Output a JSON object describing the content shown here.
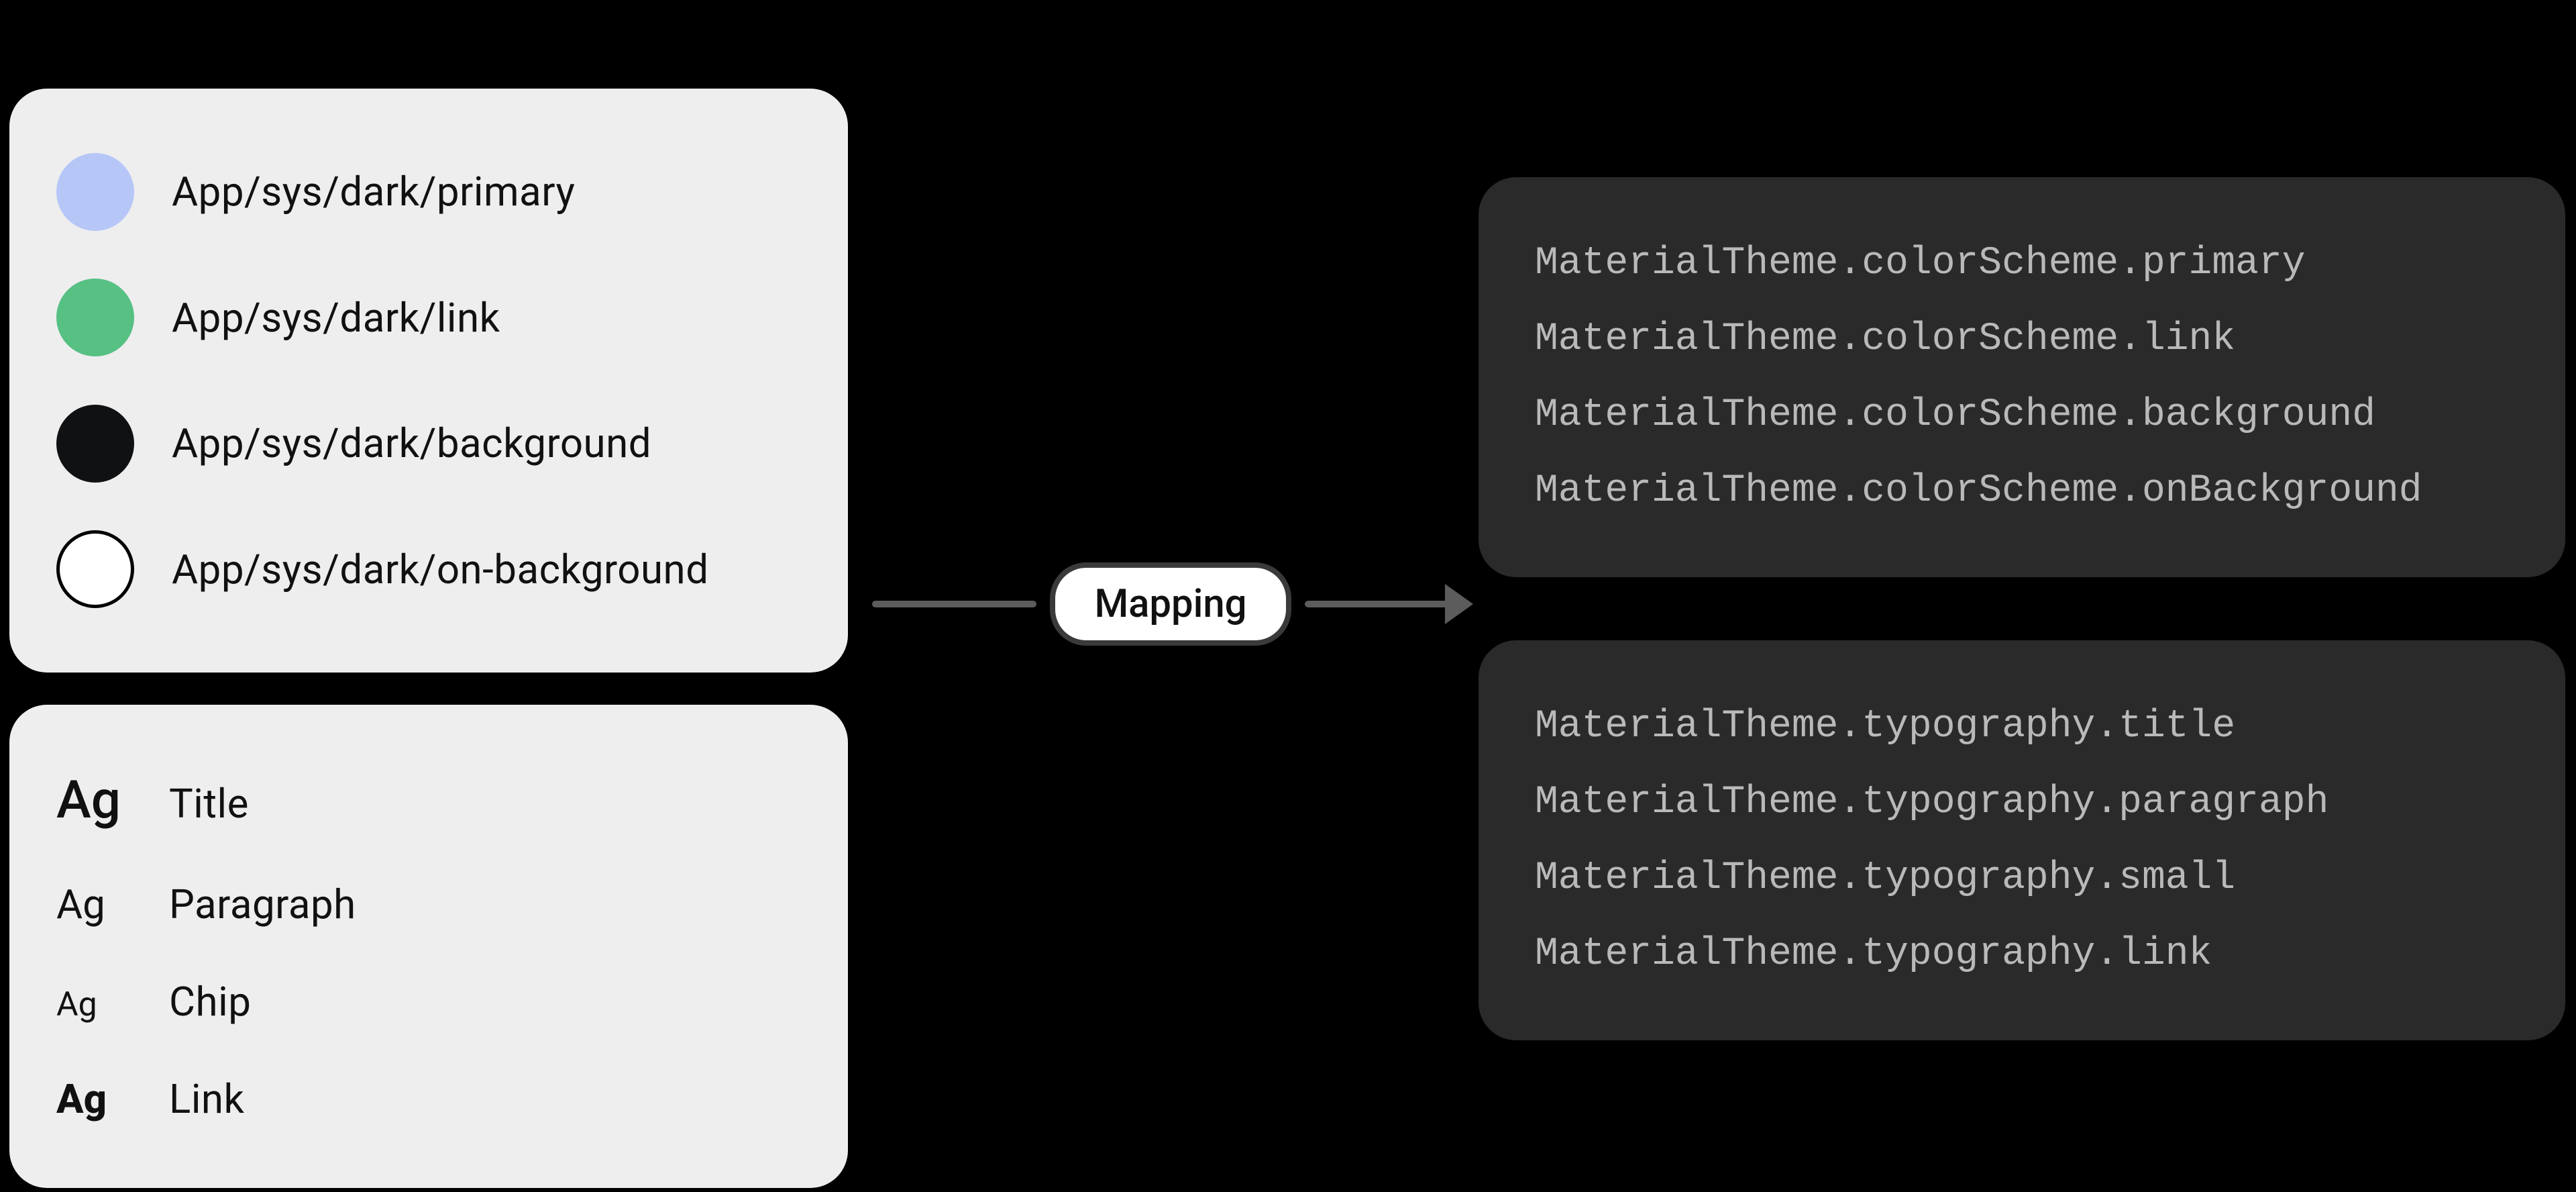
{
  "colors": {
    "tokens": [
      {
        "label": "App/sys/dark/primary",
        "hex": "#b6c7f7",
        "bordered": false
      },
      {
        "label": "App/sys/dark/link",
        "hex": "#57c083",
        "bordered": false
      },
      {
        "label": "App/sys/dark/background",
        "hex": "#0f1112",
        "bordered": false
      },
      {
        "label": "App/sys/dark/on-background",
        "hex": "#ffffff",
        "bordered": true
      }
    ]
  },
  "typography": {
    "specimen": "Ag",
    "styles": [
      {
        "label": "Title",
        "variant": "title"
      },
      {
        "label": "Paragraph",
        "variant": "para"
      },
      {
        "label": "Chip",
        "variant": "chip"
      },
      {
        "label": "Link",
        "variant": "link"
      }
    ]
  },
  "mapping": {
    "label": "Mapping"
  },
  "code": {
    "colorScheme": [
      "MaterialTheme.colorScheme.primary",
      "MaterialTheme.colorScheme.link",
      "MaterialTheme.colorScheme.background",
      "MaterialTheme.colorScheme.onBackground"
    ],
    "typography": [
      "MaterialTheme.typography.title",
      "MaterialTheme.typography.paragraph",
      "MaterialTheme.typography.small",
      "MaterialTheme.typography.link"
    ]
  }
}
